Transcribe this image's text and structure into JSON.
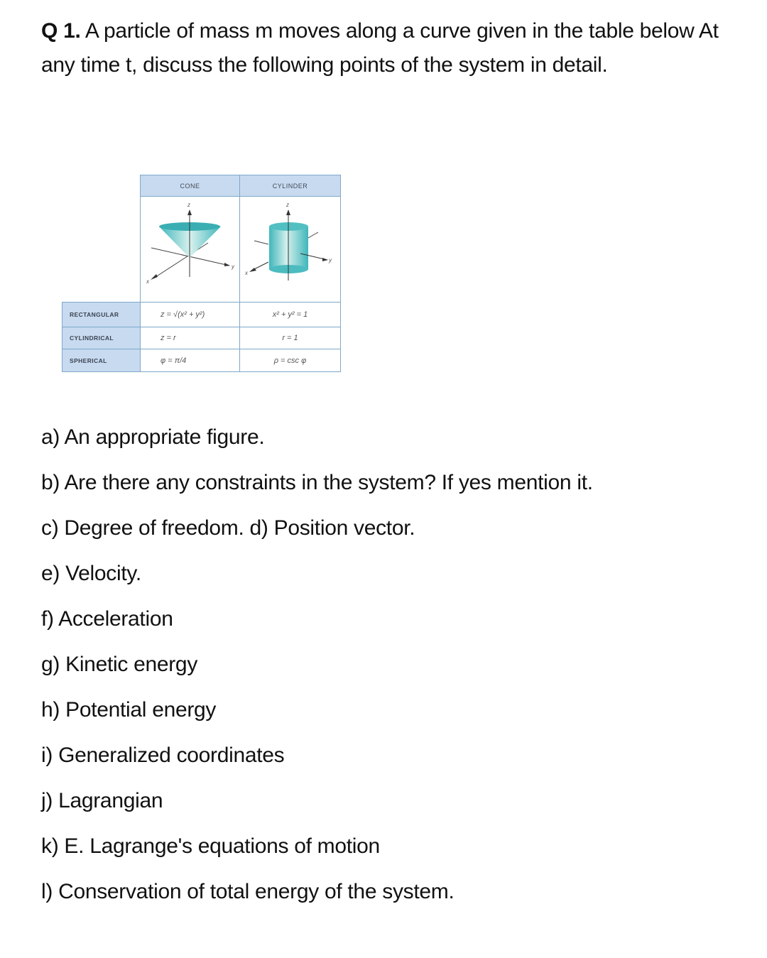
{
  "question": {
    "number": "Q 1.",
    "text": "A particle of mass m moves along a curve given in the table below At any time t, discuss the following points of the system in detail."
  },
  "table": {
    "headers": [
      "CONE",
      "CYLINDER"
    ],
    "figures": {
      "cone": {
        "axis_labels": [
          "z",
          "y",
          "x"
        ],
        "color": "#5fc6c8"
      },
      "cylinder": {
        "axis_labels": [
          "z",
          "y",
          "x"
        ],
        "color": "#5fc6c8"
      }
    },
    "rows": [
      {
        "label": "RECTANGULAR",
        "cone": "z = √(x² + y²)",
        "cylinder": "x² + y² = 1"
      },
      {
        "label": "CYLINDRICAL",
        "cone": "z = r",
        "cylinder": "r = 1"
      },
      {
        "label": "SPHERICAL",
        "cone": "φ = π/4",
        "cylinder": "ρ = csc φ"
      }
    ],
    "header_bg": "#c7daf0",
    "border_color": "#7fa8c8"
  },
  "items": [
    "a) An appropriate figure.",
    "b) Are there any constraints in the system? If yes mention it.",
    "c) Degree of freedom. d) Position vector.",
    "e) Velocity.",
    "f) Acceleration",
    "g) Kinetic energy",
    "h) Potential energy",
    "i) Generalized coordinates",
    "j) Lagrangian",
    "k) E. Lagrange's equations of motion",
    "l) Conservation of total energy of the system."
  ]
}
